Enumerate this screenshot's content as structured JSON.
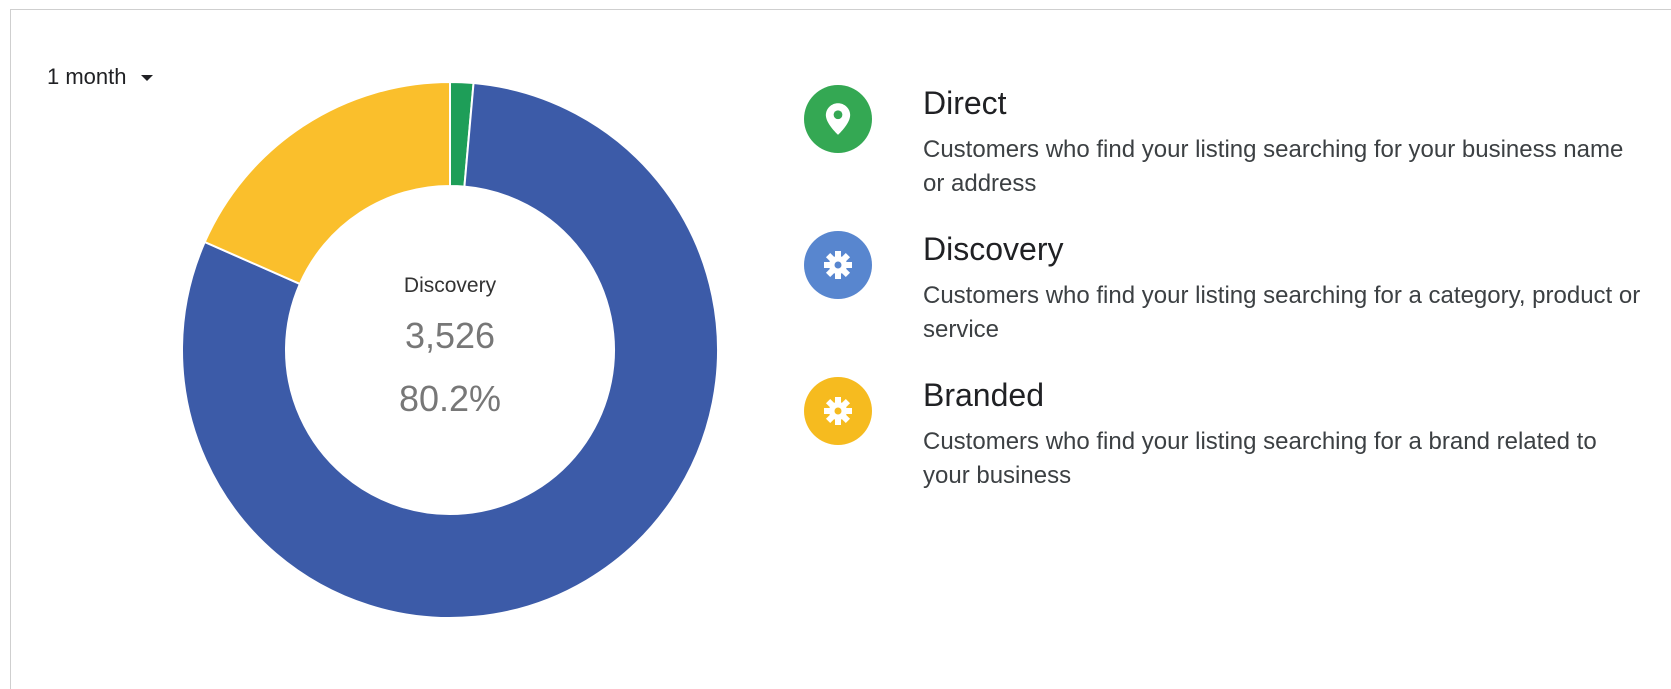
{
  "range_selector": {
    "label": "1 month"
  },
  "chart_data": {
    "type": "pie",
    "donut": true,
    "slices": [
      {
        "label": "Direct",
        "value": 1.4,
        "color": "#1e9e58"
      },
      {
        "label": "Discovery",
        "value": 80.2,
        "color": "#3c5ba8"
      },
      {
        "label": "Branded",
        "value": 18.4,
        "color": "#fabf2c"
      }
    ],
    "center_label": {
      "title": "Discovery",
      "count": "3,526",
      "percent": "80.2%"
    }
  },
  "legend": [
    {
      "title": "Direct",
      "description": "Customers who find your listing searching for your business name or address",
      "color": "#34a853",
      "icon": "location-pin-icon"
    },
    {
      "title": "Discovery",
      "description": "Customers who find your listing searching for a category, product or service",
      "color": "#5886cf",
      "icon": "gear-icon"
    },
    {
      "title": "Branded",
      "description": "Customers who find your listing searching for a brand related to your business",
      "color": "#f6bb1f",
      "icon": "gear-icon"
    }
  ]
}
